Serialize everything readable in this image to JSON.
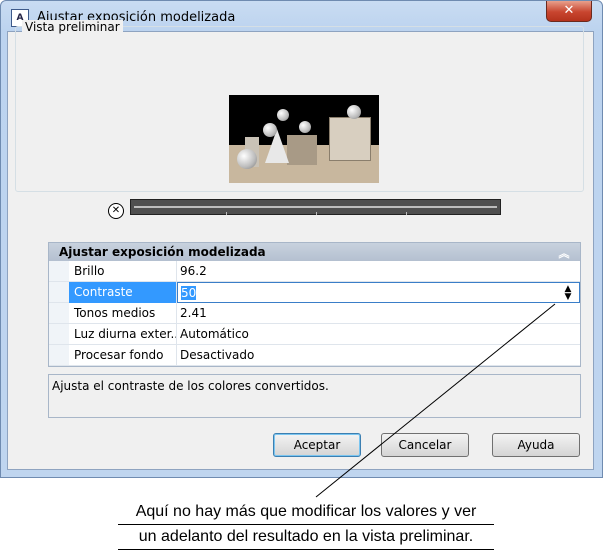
{
  "window": {
    "title": "Ajustar exposición modelizada",
    "close_label": "✕"
  },
  "preview": {
    "group_label": "Vista preliminar"
  },
  "palette": {
    "title": "Ajustar exposición modelizada",
    "rows": [
      {
        "name": "Brillo",
        "value": "96.2"
      },
      {
        "name": "Contraste",
        "value": "50"
      },
      {
        "name": "Tonos medios",
        "value": "2.41"
      },
      {
        "name": "Luz diurna exter...",
        "value": "Automático"
      },
      {
        "name": "Procesar fondo",
        "value": "Desactivado"
      }
    ]
  },
  "description": "Ajusta el contraste de los colores convertidos.",
  "buttons": {
    "ok": "Aceptar",
    "cancel": "Cancelar",
    "help": "Ayuda"
  },
  "caption": {
    "line1": "Aquí no hay más que modificar los valores y ver",
    "line2": "un adelanto del resultado en la vista preliminar."
  }
}
